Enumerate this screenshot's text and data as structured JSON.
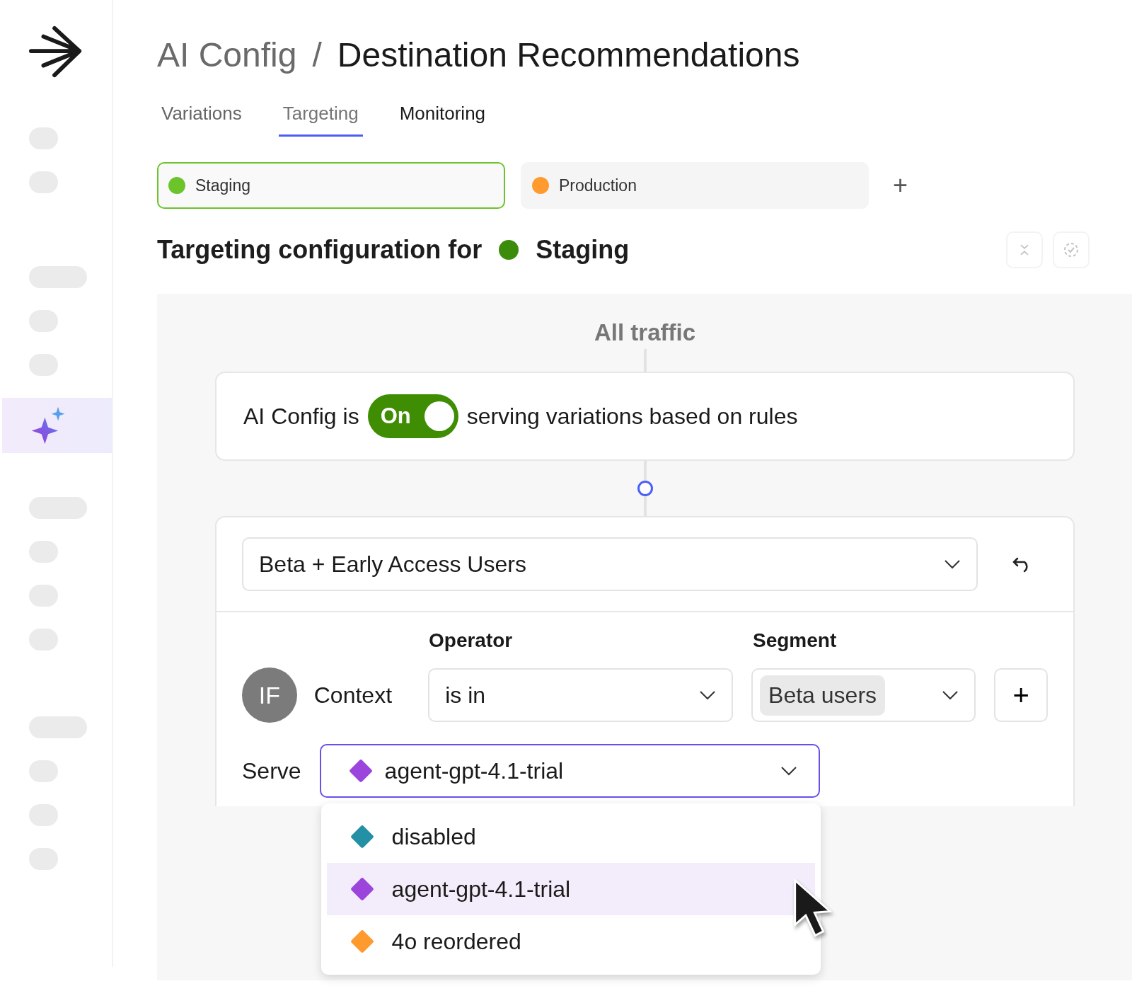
{
  "sidebar": {
    "groups": [
      {
        "items": [
          {
            "kind": "short",
            "selected": false
          },
          {
            "kind": "short",
            "selected": false
          }
        ]
      },
      {
        "items": [
          {
            "kind": "wide",
            "selected": false
          },
          {
            "kind": "short",
            "selected": false
          },
          {
            "kind": "short",
            "selected": false
          },
          {
            "kind": "sparkle",
            "selected": true
          }
        ]
      },
      {
        "items": [
          {
            "kind": "wide",
            "selected": false
          },
          {
            "kind": "short",
            "selected": false
          },
          {
            "kind": "short",
            "selected": false
          },
          {
            "kind": "short",
            "selected": false
          }
        ]
      },
      {
        "items": [
          {
            "kind": "wide",
            "selected": false
          },
          {
            "kind": "short",
            "selected": false
          },
          {
            "kind": "short",
            "selected": false
          },
          {
            "kind": "short",
            "selected": false
          }
        ]
      }
    ]
  },
  "breadcrumb": {
    "parent": "AI Config",
    "separator": "/",
    "current": "Destination Recommendations"
  },
  "tabs": [
    {
      "label": "Variations",
      "selected": false
    },
    {
      "label": "Targeting",
      "selected": true
    },
    {
      "label": "Monitoring",
      "selected": false
    }
  ],
  "environments": [
    {
      "label": "Staging",
      "color": "#6cc32a",
      "selected": true
    },
    {
      "label": "Production",
      "color": "#ff9a2e",
      "selected": false
    }
  ],
  "add_environment": "+",
  "heading": {
    "prefix": "Targeting configuration for",
    "env": "Staging"
  },
  "traffic_label": "All traffic",
  "status": {
    "prefix": "AI Config is",
    "toggle": {
      "label": "On",
      "on": true
    },
    "suffix": "serving variations based on rules"
  },
  "rule": {
    "name": "Beta + Early Access Users",
    "clause": {
      "badge": "IF",
      "attribute": "Context",
      "operator_label": "Operator",
      "operator": "is in",
      "segment_label": "Segment",
      "segment": "Beta users",
      "add": "+"
    },
    "serve_label": "Serve",
    "serve": {
      "name": "agent-gpt-4.1-trial",
      "color": "#9b45dc"
    },
    "options": [
      {
        "name": "disabled",
        "color": "#2490a6",
        "selected": false
      },
      {
        "name": "agent-gpt-4.1-trial",
        "color": "#9b45dc",
        "selected": true
      },
      {
        "name": "4o reordered",
        "color": "#ff9a2e",
        "selected": false
      }
    ]
  }
}
